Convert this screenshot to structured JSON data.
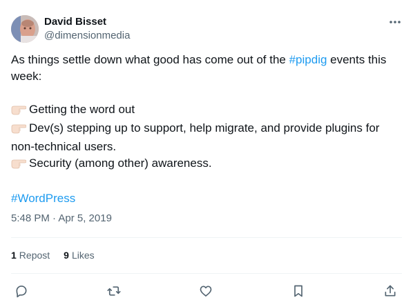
{
  "author": {
    "display_name": "David Bisset",
    "handle": "@dimensionmedia"
  },
  "tweet": {
    "line1_prefix": "As things settle down what good has come out of the ",
    "hashtag_inline": "#pipdig",
    "line1_suffix": " events this week:",
    "bullets": [
      "Getting the word out",
      "Dev(s) stepping up to support, help migrate, and provide plugins for non-technical users.",
      "Security (among other) awareness."
    ],
    "bullet_icon": "backhand-index-pointing-right-emoji",
    "hashtag_footer": "#WordPress",
    "timestamp": "5:48 PM · Apr 5, 2019"
  },
  "stats": {
    "reposts_count": "1",
    "reposts_label": "Repost",
    "likes_count": "9",
    "likes_label": "Likes"
  },
  "actions": [
    "reply-icon",
    "repost-icon",
    "like-icon",
    "bookmark-icon",
    "share-icon"
  ],
  "colors": {
    "link": "#1d9bf0",
    "primary_text": "#0f1419",
    "secondary_text": "#536471",
    "divider": "#eff3f4"
  }
}
